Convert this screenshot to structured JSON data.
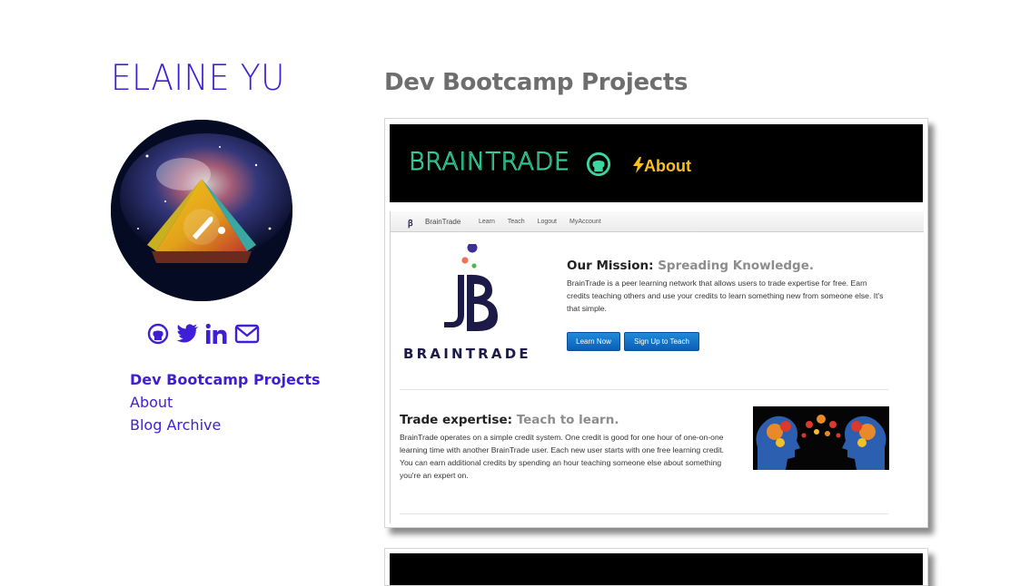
{
  "sidebar": {
    "site_title": "ELAINE YU",
    "social_icons": [
      "github-icon",
      "twitter-icon",
      "linkedin-icon",
      "envelope-icon"
    ],
    "nav": [
      {
        "label": "Dev Bootcamp Projects",
        "active": true
      },
      {
        "label": "About",
        "active": false
      },
      {
        "label": "Blog Archive",
        "active": false
      }
    ]
  },
  "main": {
    "heading": "Dev Bootcamp Projects",
    "project": {
      "banner_title": "BRAINTRADE",
      "about_link": "About",
      "screenshot": {
        "nav_brand": "BrainTrade",
        "nav_links": [
          "Learn",
          "Teach",
          "Logout",
          "MyAccount"
        ],
        "logo_word": "BRAINTRADE",
        "mission_title": "Our Mission:",
        "mission_accent": "Spreading Knowledge.",
        "mission_text": "BrainTrade is a peer learning network that allows users to trade expertise for free. Earn credits teaching others and use your credits to learn something new from someone else. It's that simple.",
        "buttons": [
          "Learn Now",
          "Sign Up to Teach"
        ],
        "trade_title": "Trade expertise:",
        "trade_accent": "Teach to learn.",
        "trade_text": "BrainTrade operates on a simple credit system. One credit is good for one hour of one-on-one learning time with another BrainTrade user. Each new user starts with one free learning credit. You can earn additional credits by spending an hour teaching someone else about something you're an expert on."
      }
    }
  },
  "colors": {
    "accent": "#3f1ed6",
    "heading_gray": "#6e6e6e",
    "banner_green": "#38d8a0",
    "about_yellow": "#f7c11c",
    "button_blue": "#1a78cc"
  }
}
